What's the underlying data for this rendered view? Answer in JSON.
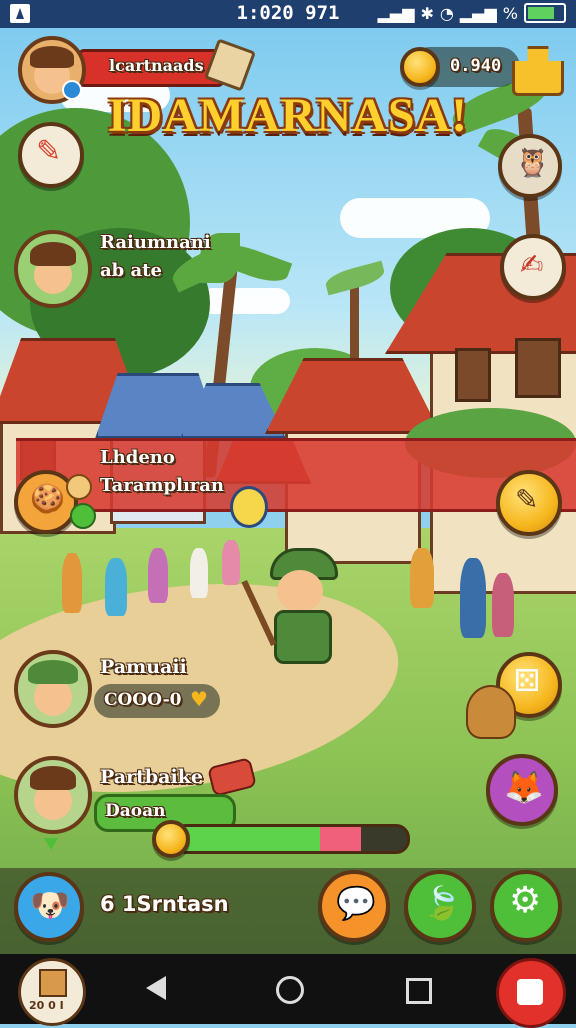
{
  "status_bar": {
    "time": "1:020 971",
    "percent": "%"
  },
  "header": {
    "player_name": "lcartnaads",
    "coin_amount": "0.940",
    "title": "IDAMARNASA!"
  },
  "quest_card": {
    "line1": "Raiumnani",
    "line2": "ab ate"
  },
  "event_banner": {
    "line1": "Lhdeno",
    "line2": "Taramplıran"
  },
  "player_card_1": {
    "name": "Pamuaii",
    "value": "COOO-0"
  },
  "player_card_2": {
    "name": "Partbaike",
    "value": "Daoan",
    "xp_fraction": 0.82,
    "red_fraction": 0.18
  },
  "bottom_bar": {
    "label": "6 1Srntasn"
  },
  "navbar": {
    "app_badge": "20 0 I"
  },
  "colors": {
    "accent_red": "#d63a30",
    "gold": "#f6b71e",
    "green": "#4fbf3a"
  }
}
